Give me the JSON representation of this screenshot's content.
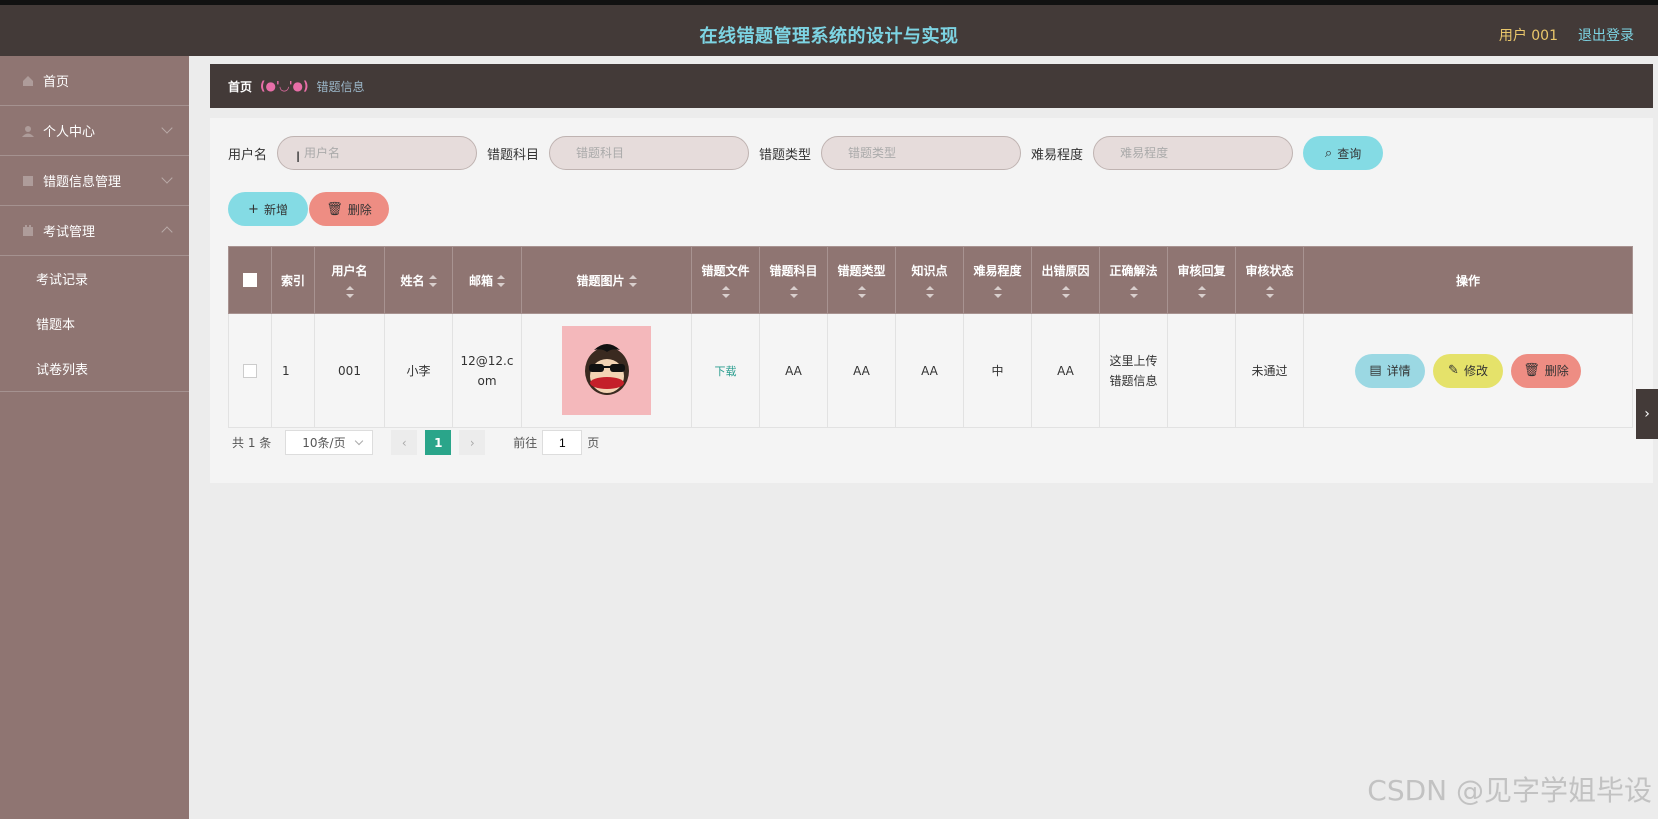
{
  "header": {
    "title": "在线错题管理系统的设计与实现",
    "user": "用户 001",
    "logout": "退出登录"
  },
  "sidebar": {
    "items": [
      {
        "label": "首页",
        "icon": "home-icon"
      },
      {
        "label": "个人中心",
        "icon": "user-icon"
      },
      {
        "label": "错题信息管理",
        "icon": "document-icon"
      },
      {
        "label": "考试管理",
        "icon": "exam-icon"
      }
    ],
    "sub_items": [
      "考试记录",
      "错题本",
      "试卷列表"
    ]
  },
  "breadcrumb": {
    "home": "首页",
    "separator": "(●'◡'●)",
    "current": "错题信息"
  },
  "search": {
    "fields": [
      {
        "label": "用户名",
        "placeholder": "用户名"
      },
      {
        "label": "错题科目",
        "placeholder": "错题科目"
      },
      {
        "label": "错题类型",
        "placeholder": "错题类型"
      },
      {
        "label": "难易程度",
        "placeholder": "难易程度"
      }
    ],
    "query_button": "查询"
  },
  "actions": {
    "add": "新增",
    "delete": "删除"
  },
  "table": {
    "columns": [
      "索引",
      "用户名",
      "姓名",
      "邮箱",
      "错题图片",
      "错题文件",
      "错题科目",
      "错题类型",
      "知识点",
      "难易程度",
      "出错原因",
      "正确解法",
      "审核回复",
      "审核状态",
      "操作"
    ],
    "rows": [
      {
        "index": "1",
        "username": "001",
        "name": "小李",
        "email": "12@12.com",
        "file": "下载",
        "subject": "AA",
        "type": "AA",
        "knowledge": "AA",
        "difficulty": "中",
        "reason": "AA",
        "solution": "这里上传错题信息",
        "reply": "",
        "status": "未通过"
      }
    ],
    "row_buttons": {
      "detail": "详情",
      "edit": "修改",
      "delete": "删除"
    }
  },
  "pagination": {
    "total": "共 1 条",
    "page_size": "10条/页",
    "current": "1",
    "goto": "前往",
    "goto_value": "1",
    "page_unit": "页"
  },
  "watermark": "CSDN @见字学姐毕设"
}
